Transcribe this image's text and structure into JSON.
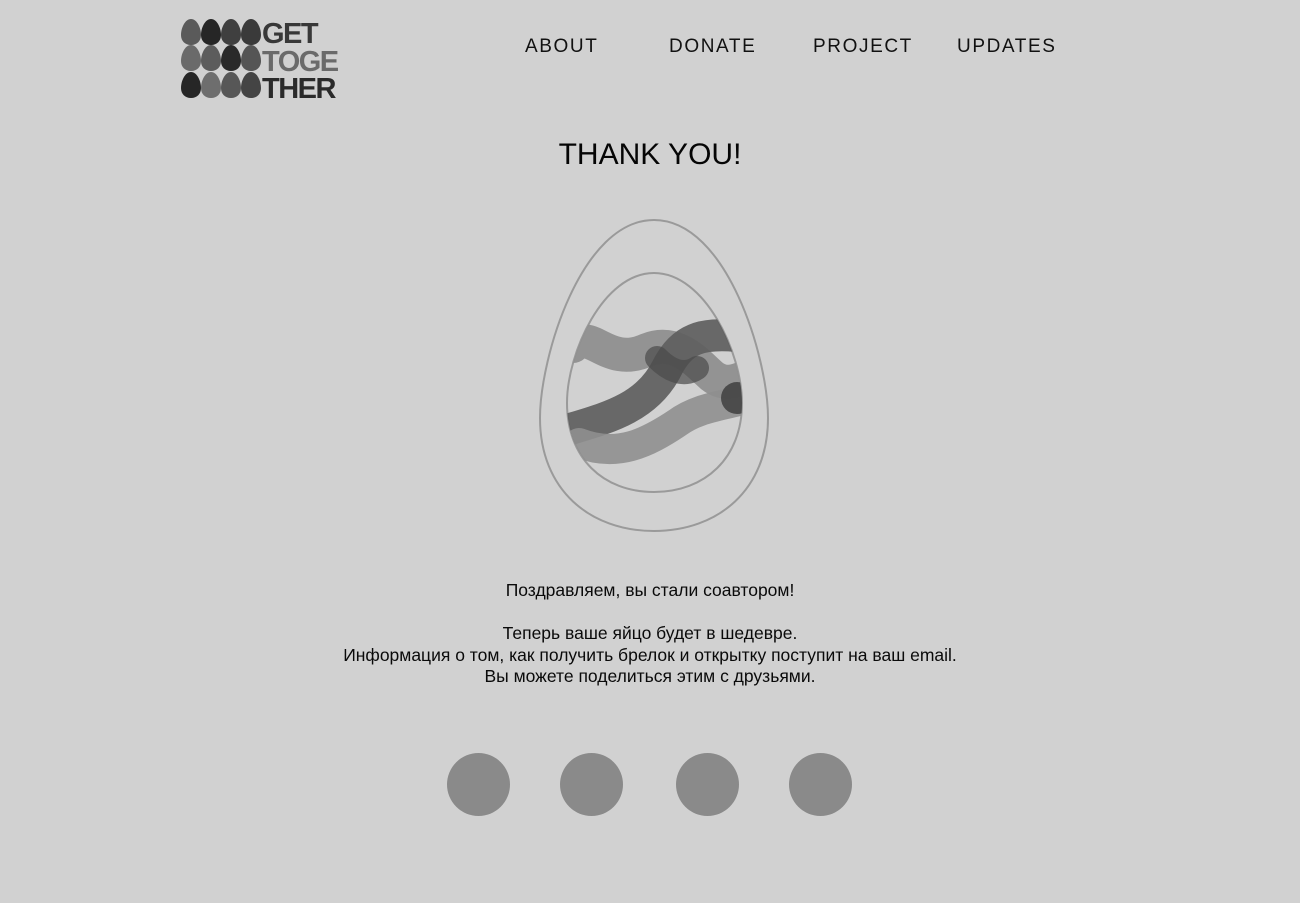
{
  "logo": {
    "lines": [
      "GET",
      "TOGE",
      "THER"
    ],
    "icon": "eggs-grid-logo"
  },
  "nav": {
    "items": [
      {
        "label": "ABOUT"
      },
      {
        "label": "DONATE"
      },
      {
        "label": "PROJECT"
      },
      {
        "label": "UPDATES"
      }
    ]
  },
  "page": {
    "title": "THANK YOU!"
  },
  "egg": {
    "icon": "decorated-egg-illustration"
  },
  "message": {
    "congrats": "Поздравляем, вы стали соавтором!",
    "line1": "Теперь ваше яйцо будет в шедевре.",
    "line2": "Информация о том, как получить брелок и открытку поступит на ваш email.",
    "line3": "Вы можете поделиться этим с друзьями."
  },
  "share": {
    "buttons": [
      {
        "icon": "share-button-icon"
      },
      {
        "icon": "share-button-icon"
      },
      {
        "icon": "share-button-icon"
      },
      {
        "icon": "share-button-icon"
      }
    ]
  },
  "colors": {
    "background": "#d1d1d1",
    "share_button": "#8a8a8a",
    "egg_outline": "#9a9a9a",
    "logo_dark": "#2a2a2a",
    "logo_mid": "#5a5a5a",
    "logo_light": "#6e6e6e"
  }
}
